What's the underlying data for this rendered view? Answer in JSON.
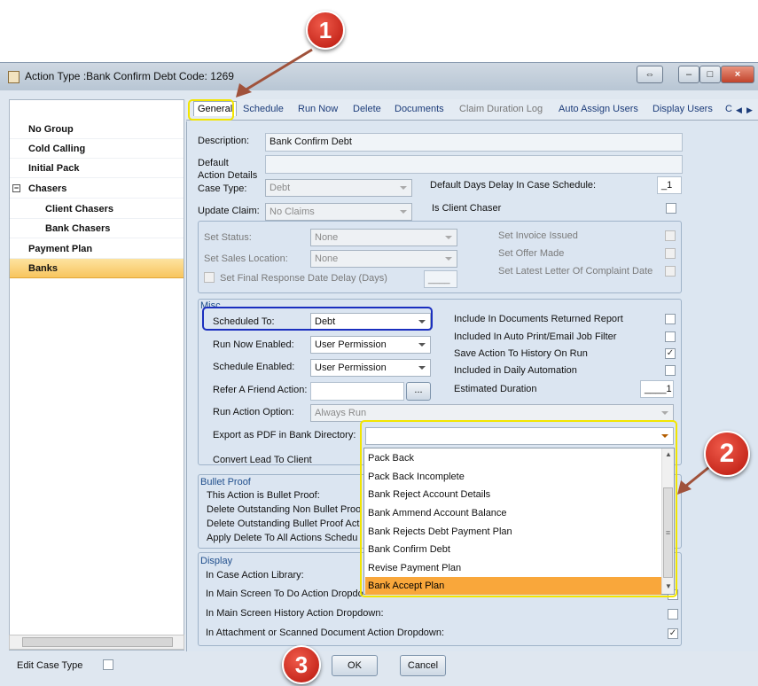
{
  "window": {
    "title": "Action Type :Bank Confirm Debt Code: 1269",
    "controls": [
      "⇔",
      "–",
      "□",
      "×"
    ]
  },
  "sidebar": {
    "items": [
      {
        "label": "No Group"
      },
      {
        "label": "Cold Calling"
      },
      {
        "label": "Initial Pack"
      },
      {
        "label": "Chasers",
        "expander": "−"
      },
      {
        "label": "Client Chasers"
      },
      {
        "label": "Bank Chasers"
      },
      {
        "label": "Payment Plan"
      },
      {
        "label": "Banks",
        "selected": true
      }
    ],
    "edit_case_type_label": "Edit Case Type"
  },
  "tabs": [
    "General",
    "Schedule",
    "Run Now",
    "Delete",
    "Documents",
    "Claim Duration Log",
    "Auto Assign Users",
    "Display Users",
    "C"
  ],
  "tab_nav": {
    "prev": "◀",
    "next": "▶"
  },
  "general": {
    "description_label": "Description:",
    "description_value": "Bank Confirm Debt",
    "default_action_details_label_1": "Default",
    "default_action_details_label_2": "Action Details",
    "case_type_label": "Case Type:",
    "case_type_value": "Debt",
    "update_claim_label": "Update Claim:",
    "update_claim_value": "No Claims",
    "default_days_delay_label": "Default Days Delay In Case Schedule:",
    "default_days_delay_value": "_1",
    "is_client_chaser_label": "Is Client Chaser"
  },
  "status_panel": {
    "set_status_label": "Set Status:",
    "set_status_value": "None",
    "set_sales_location_label": "Set Sales Location:",
    "set_sales_location_value": "None",
    "set_final_response_label": "Set Final Response Date Delay (Days)",
    "set_final_response_value": "____",
    "set_invoice_issued_label": "Set Invoice Issued",
    "set_offer_made_label": "Set Offer Made",
    "set_latest_letter_label": "Set Latest Letter Of Complaint Date"
  },
  "misc": {
    "header": "Misc",
    "scheduled_to_label": "Scheduled To:",
    "scheduled_to_value": "Debt",
    "run_now_enabled_label": "Run Now Enabled:",
    "run_now_enabled_value": "User Permission",
    "schedule_enabled_label": "Schedule Enabled:",
    "schedule_enabled_value": "User Permission",
    "refer_friend_label": "Refer A Friend Action:",
    "refer_friend_button": "...",
    "run_action_option_label": "Run Action Option:",
    "run_action_option_value": "Always Run",
    "export_pdf_label": "Export as PDF in Bank Directory:",
    "convert_lead_label": "Convert Lead To Client",
    "include_docs_label": "Include In Documents Returned Report",
    "include_auto_print_label": "Included In Auto Print/Email Job Filter",
    "save_action_label": "Save Action To History On Run",
    "daily_automation_label": "Included in Daily Automation",
    "estimated_duration_label": "Estimated Duration",
    "estimated_duration_value": "____1",
    "checked_mark": "✓"
  },
  "dropdown": {
    "items": [
      "Pack Back",
      "Pack Back Incomplete",
      "Bank Reject Account Details",
      "Bank Ammend Account Balance",
      "Bank Rejects Debt Payment Plan",
      "Bank Confirm Debt",
      "Revise Payment Plan",
      "Bank Accept Plan"
    ],
    "selected_index": 7,
    "scroll_up": "▲",
    "scroll_down": "▼",
    "grip": "≡"
  },
  "bullet_proof": {
    "header": "Bullet Proof",
    "rows": [
      "This Action is Bullet Proof:",
      "Delete Outstanding Non Bullet Proo",
      "Delete Outstanding Bullet Proof Act",
      "Apply Delete To All Actions Schedu"
    ]
  },
  "display": {
    "header": "Display",
    "rows": [
      "In Case Action Library:",
      "In Main Screen To Do Action Dropdo",
      "In Main Screen History Action Dropdown:",
      "In Attachment or Scanned Document Action Dropdown:"
    ]
  },
  "buttons": {
    "ok": "OK",
    "cancel": "Cancel"
  },
  "callouts": [
    "1",
    "2",
    "3"
  ],
  "colors": {
    "highlight_yellow": "#f2e500",
    "highlight_blue": "#1b2fbf",
    "callout_red": "#c8241a",
    "selection_orange": "#f9a73b",
    "arrow_brown": "#a0523b"
  }
}
